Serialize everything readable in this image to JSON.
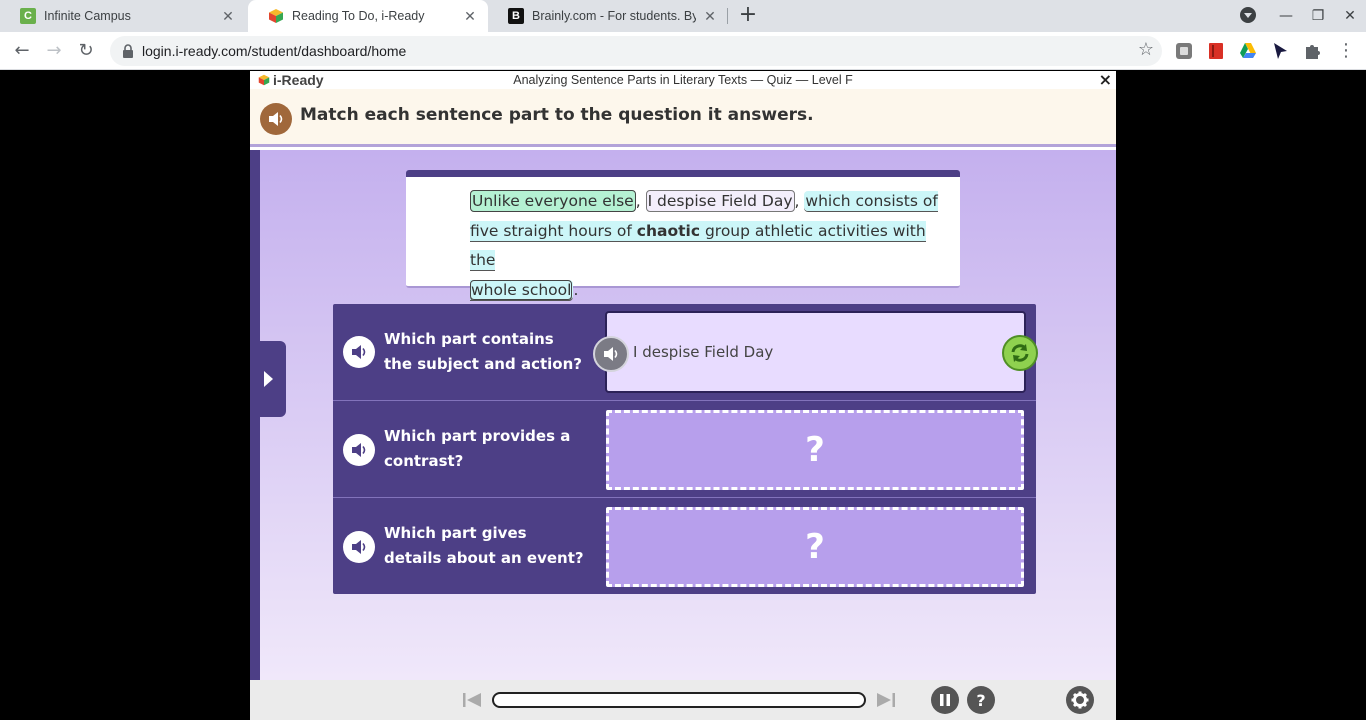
{
  "browser": {
    "tabs": [
      {
        "title": "Infinite Campus",
        "favicon": "C"
      },
      {
        "title": "Reading To Do, i-Ready",
        "favicon": ""
      },
      {
        "title": "Brainly.com - For students. By students.",
        "favicon": "B"
      }
    ],
    "url": "login.i-ready.com/student/dashboard/home"
  },
  "app": {
    "logo": "i-Ready",
    "lesson_title": "Analyzing Sentence Parts in Literary Texts — Quiz — Level F",
    "close_label": "×",
    "instruction": "Match each sentence part to the question it answers."
  },
  "passage": {
    "part1": "Unlike everyone else",
    "comma1": ",",
    "part2": "I despise Field Day",
    "comma2": ",",
    "part3a": "which consists of",
    "part3b": "five straight hours of ",
    "part3_bold": "chaotic",
    "part3c": " group athletic activities with the",
    "part3d": "whole school",
    "period": "."
  },
  "questions": [
    {
      "text": "Which part contains the subject and action?",
      "answer": "I despise Field Day"
    },
    {
      "text": "Which part provides a contrast?",
      "answer": "?"
    },
    {
      "text": "Which part gives details about an event?",
      "answer": "?"
    }
  ],
  "footer": {
    "progress": 0,
    "help_label": "?"
  },
  "colors": {
    "brand_purple": "#4d3f86",
    "answer_green_chip": "#b5f1d3",
    "answer_cyan_chip": "#ccf6f8"
  }
}
